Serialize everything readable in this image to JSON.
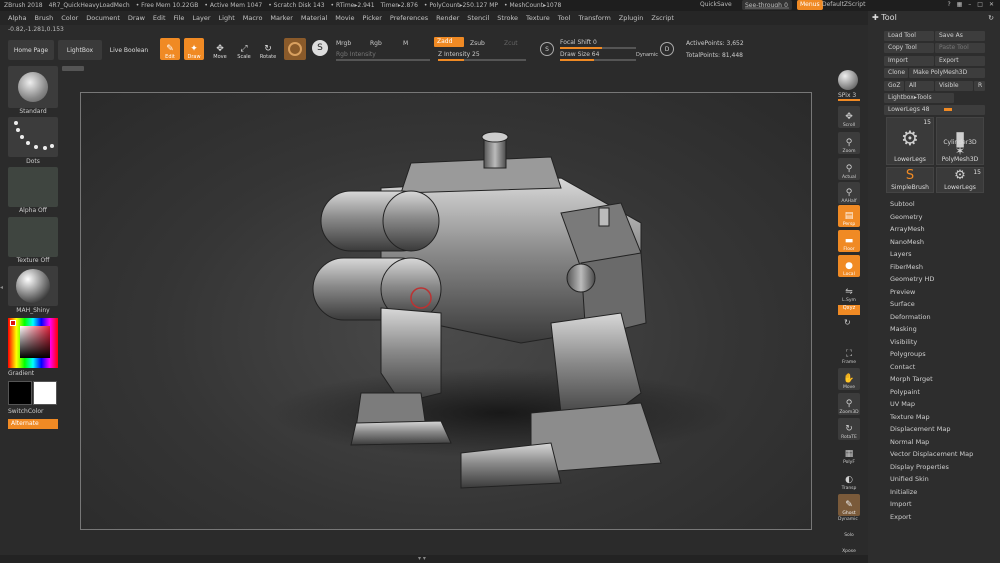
{
  "titlebar": {
    "app": "ZBrush 2018",
    "doc": "4R7_QuickHeavyLoadMech",
    "stats": [
      "• Free Mem 10.22GB",
      "• Active Mem 1047",
      "• Scratch Disk 143",
      "• RTime▸2.941",
      "Timer▸2.876",
      "• PolyCount▸250.127 MP",
      "• MeshCount▸1078"
    ],
    "quicksave": "QuickSave",
    "seethrough": "See-through",
    "seethrough_value": "0",
    "menus": "Menus",
    "defaultzscript": "DefaultZScript"
  },
  "menubar": [
    "Alpha",
    "Brush",
    "Color",
    "Document",
    "Draw",
    "Edit",
    "File",
    "Layer",
    "Light",
    "Macro",
    "Marker",
    "Material",
    "Movie",
    "Picker",
    "Preferences",
    "Render",
    "Stencil",
    "Stroke",
    "Texture",
    "Tool",
    "Transform",
    "Zplugin",
    "Zscript"
  ],
  "coords": "-0.82,-1.281,0.153",
  "toolbar": {
    "home": "Home Page",
    "lightbox": "LightBox",
    "liveboolean": "Live Boolean",
    "edit": "Edit",
    "draw": "Draw",
    "move": "Move",
    "scale": "Scale",
    "rotate": "Rotate",
    "mrgb": "Mrgb",
    "rgb": "Rgb",
    "m": "M",
    "zadd": "Zadd",
    "zsub": "Zsub",
    "zcut": "Zcut",
    "rgb_intensity": "Rgb Intensity",
    "z_intensity": "Z Intensity 25",
    "focal_shift": "Focal Shift 0",
    "draw_size": "Draw Size 64",
    "dynamic": "Dynamic",
    "active_points": "ActivePoints: 3,652",
    "total_points": "TotalPoints: 81,448"
  },
  "leftshelf": {
    "brush": "Standard",
    "stroke": "Dots",
    "alpha": "Alpha Off",
    "texture": "Texture Off",
    "material": "MAH_Shiny",
    "gradient": "Gradient",
    "switchcolor": "SwitchColor",
    "alternate": "Alternate"
  },
  "rightshelf": {
    "spix": "SPix 3",
    "buttons": [
      "Scroll",
      "Zoom",
      "Actual",
      "AAHalf",
      "Persp",
      "Floor",
      "Local",
      "L.Sym",
      "Qxyz",
      "",
      "Frame",
      "Move",
      "Zoom3D",
      "RotaTE",
      "PolyF",
      "Transp",
      "Ghost",
      "Dynamic",
      "Solo",
      "Xpose"
    ]
  },
  "toolpanel": {
    "title": "Tool",
    "load_tool": "Load Tool",
    "save_as": "Save As",
    "copy_tool": "Copy Tool",
    "paste_tool": "Paste Tool",
    "import": "Import",
    "export": "Export",
    "clone": "Clone",
    "make_polymesh": "Make PolyMesh3D",
    "goz": "GoZ",
    "all": "All",
    "visible": "Visible",
    "r": "R",
    "lightbox_tools": "Lightbox▸Tools",
    "lowerlegs_slider": "LowerLegs",
    "lowerlegs_value": "48",
    "thumbs": [
      {
        "label": "LowerLegs",
        "num": "15",
        "glyph": "⚙"
      },
      {
        "label": "Cylinder3D",
        "num": "",
        "glyph": "▮"
      },
      {
        "label": "",
        "num": "",
        "glyph": ""
      },
      {
        "label": "PolyMesh3D",
        "num": "",
        "glyph": "✶"
      },
      {
        "label": "SimpleBrush",
        "num": "",
        "glyph": "S"
      },
      {
        "label": "LowerLegs",
        "num": "15",
        "glyph": "⚙"
      }
    ],
    "subpalettes": [
      "Subtool",
      "Geometry",
      "ArrayMesh",
      "NanoMesh",
      "Layers",
      "FiberMesh",
      "Geometry HD",
      "Preview",
      "Surface",
      "Deformation",
      "Masking",
      "Visibility",
      "Polygroups",
      "Contact",
      "Morph Target",
      "Polypaint",
      "UV Map",
      "Texture Map",
      "Displacement Map",
      "Normal Map",
      "Vector Displacement Map",
      "Display Properties",
      "Unified Skin",
      "Initialize",
      "Import",
      "Export"
    ]
  },
  "colors": {
    "accent": "#f08a24",
    "panel": "#2d2d2d"
  }
}
